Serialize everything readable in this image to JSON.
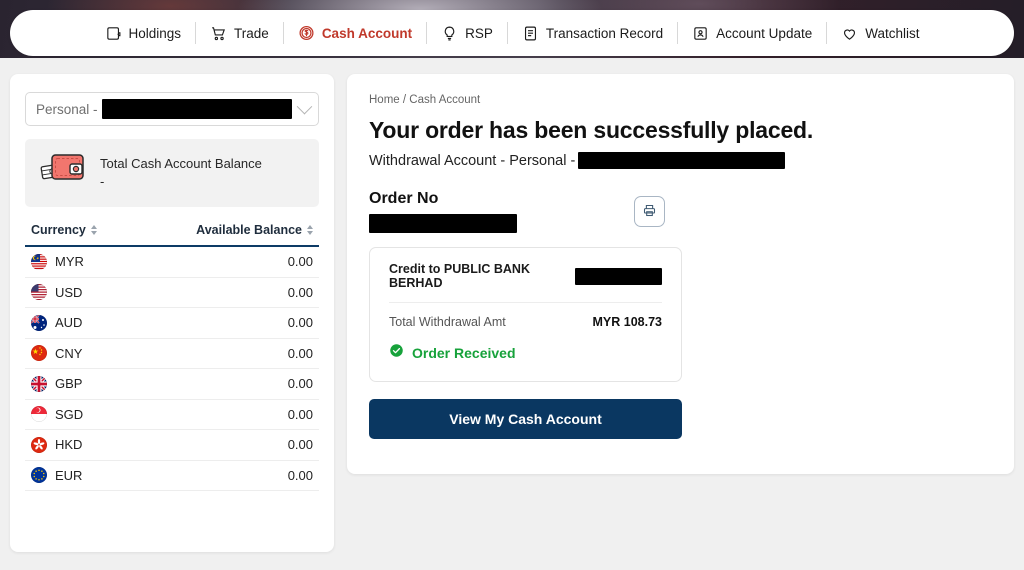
{
  "nav": {
    "items": [
      {
        "label": "Holdings",
        "icon": "wallet-icon",
        "active": false
      },
      {
        "label": "Trade",
        "icon": "shopping-cart-icon",
        "active": false
      },
      {
        "label": "Cash Account",
        "icon": "coin-dollar-icon",
        "active": true
      },
      {
        "label": "RSP",
        "icon": "lightbulb-icon",
        "active": false
      },
      {
        "label": "Transaction Record",
        "icon": "clipboard-list-icon",
        "active": false
      },
      {
        "label": "Account Update",
        "icon": "id-card-icon",
        "active": false
      },
      {
        "label": "Watchlist",
        "icon": "heart-icon",
        "active": false
      }
    ]
  },
  "sidebar": {
    "account_select": {
      "label": "Personal -",
      "value_redacted": true,
      "chevron": "chevron-down-icon"
    },
    "balance_card": {
      "icon": "wallet-cash-icon",
      "title": "Total Cash Account Balance",
      "value": "-"
    },
    "table": {
      "columns": [
        "Currency",
        "Available Balance"
      ],
      "rows": [
        {
          "code": "MYR",
          "balance": "0.00"
        },
        {
          "code": "USD",
          "balance": "0.00"
        },
        {
          "code": "AUD",
          "balance": "0.00"
        },
        {
          "code": "CNY",
          "balance": "0.00"
        },
        {
          "code": "GBP",
          "balance": "0.00"
        },
        {
          "code": "SGD",
          "balance": "0.00"
        },
        {
          "code": "HKD",
          "balance": "0.00"
        },
        {
          "code": "EUR",
          "balance": "0.00"
        }
      ]
    }
  },
  "main": {
    "breadcrumb": {
      "home": "Home",
      "separator": "/",
      "current": "Cash Account"
    },
    "headline": "Your order has been successfully placed.",
    "withdrawal_account_label": "Withdrawal Account - Personal -",
    "order_no_label": "Order No",
    "print_button_icon": "printer-icon",
    "detail": {
      "credit_to_label": "Credit to PUBLIC BANK BERHAD",
      "total_label": "Total Withdrawal Amt",
      "total_value": "MYR 108.73",
      "status_icon": "check-circle-icon",
      "status_text": "Order Received"
    },
    "cta_label": "View My Cash Account"
  },
  "colors": {
    "accent_red": "#c0392b",
    "navy": "#0a3761",
    "success_green": "#17a23b",
    "page_bg": "#f0f0f0"
  }
}
